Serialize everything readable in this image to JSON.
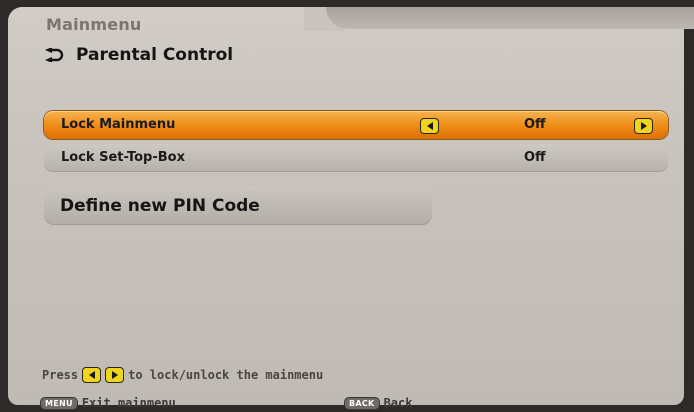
{
  "header": {
    "title": "Mainmenu",
    "subtitle": "Parental Control",
    "subtitle_icon": "back-arrow-icon"
  },
  "menu": {
    "items": [
      {
        "label": "Lock Mainmenu",
        "value": "Off",
        "selected": true
      },
      {
        "label": "Lock Set-Top-Box",
        "value": "Off",
        "selected": false
      }
    ],
    "pin_button": "Define new PIN Code"
  },
  "hint": {
    "prefix": "Press",
    "suffix": "to lock/unlock the mainmenu"
  },
  "footer": {
    "menu_key": "MENU",
    "menu_label": "Exit mainmenu",
    "back_key": "BACK",
    "back_label": "Back"
  },
  "colors": {
    "selected": "#ee8a15",
    "panel": "#c8c2bc",
    "arrow_button": "#f0d51f"
  }
}
